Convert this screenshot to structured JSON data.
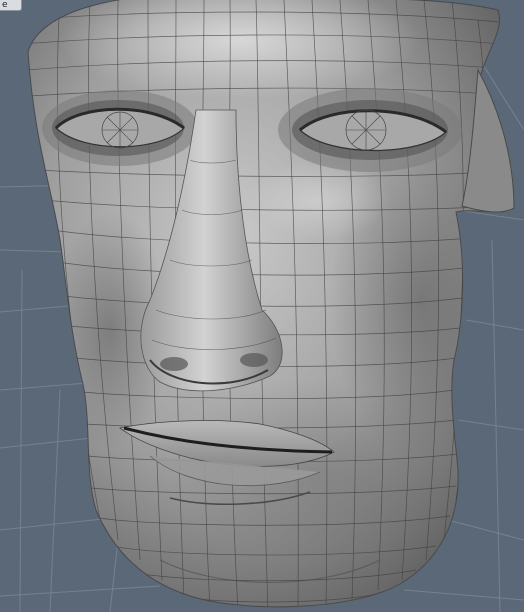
{
  "viewport": {
    "tab_label": "e",
    "background_color": "#5b6878",
    "grid_color": "#7c8898",
    "mesh_color": "#3f3f3f",
    "model": "head-wireframe-mesh"
  }
}
